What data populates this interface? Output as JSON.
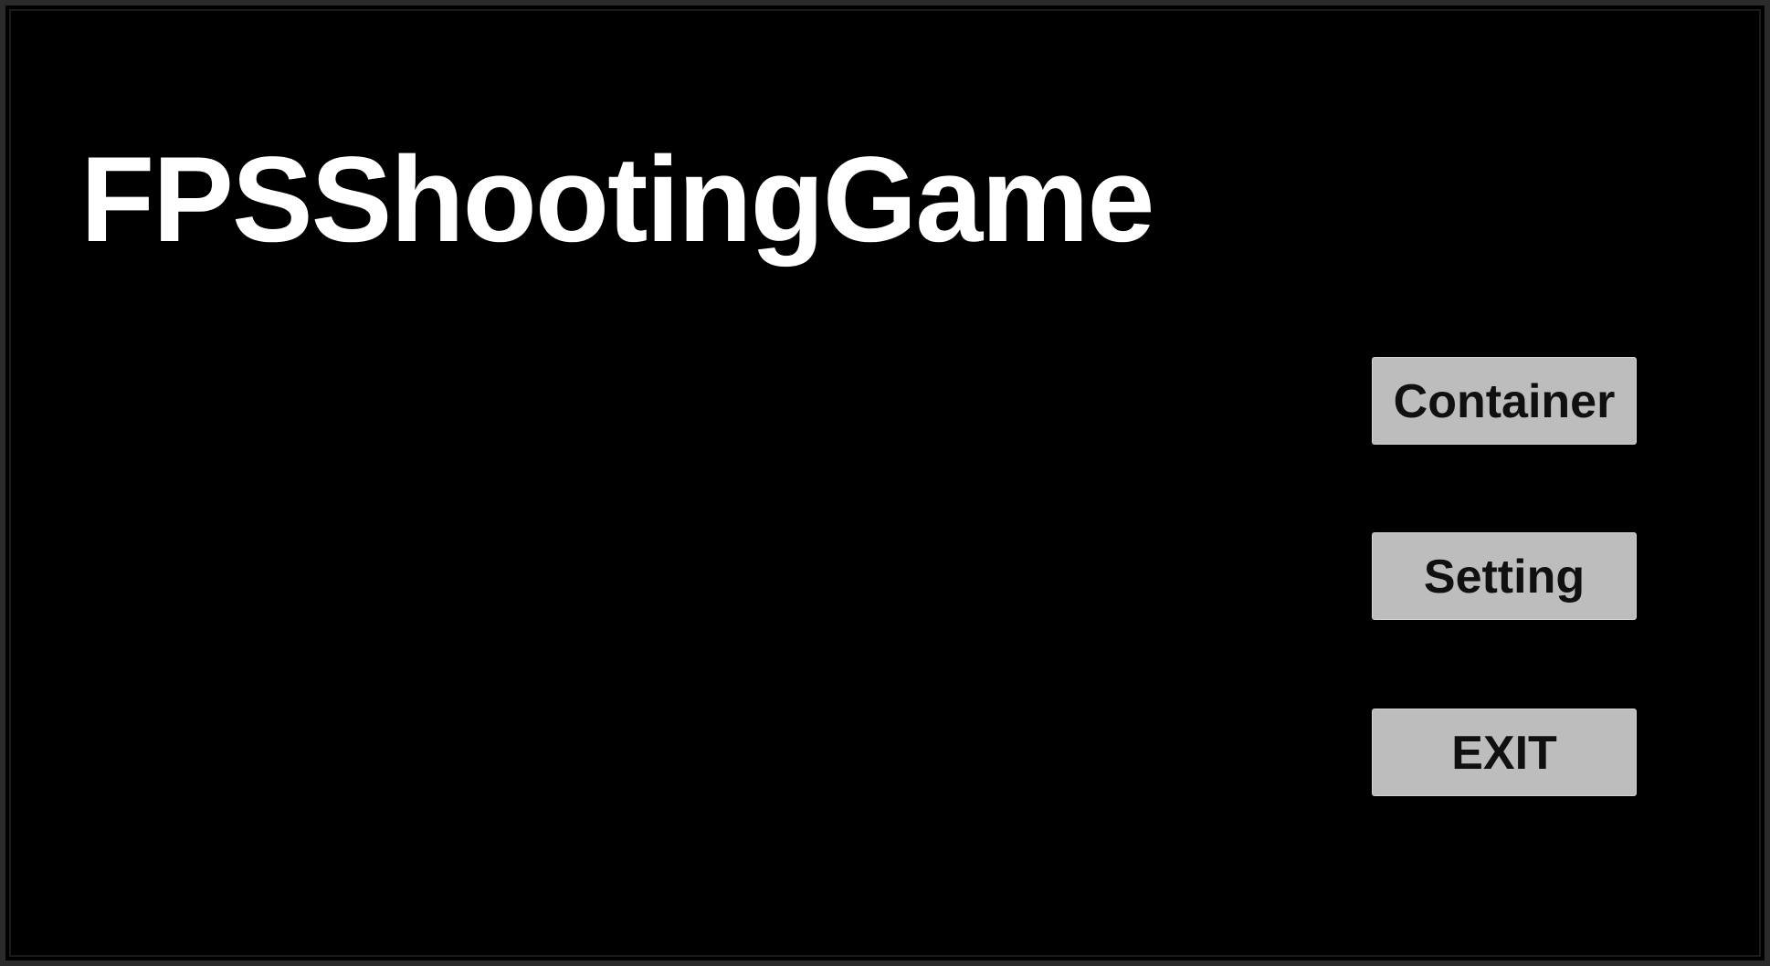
{
  "game": {
    "title": "FPSShootingGame"
  },
  "menu": {
    "container_label": "Container",
    "setting_label": "Setting",
    "exit_label": "EXIT"
  },
  "colors": {
    "background": "#000000",
    "title_text": "#ffffff",
    "button_background": "#bdbdbd",
    "button_text": "#101010"
  }
}
